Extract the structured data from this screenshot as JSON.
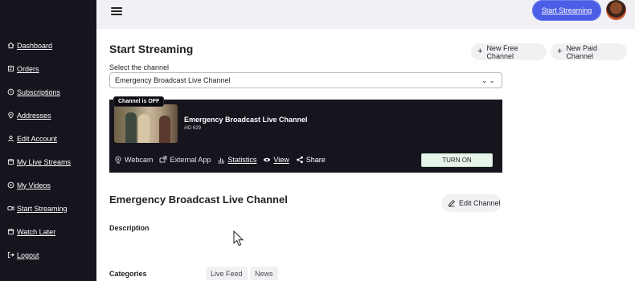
{
  "sidebar": {
    "items": [
      {
        "label": "Dashboard",
        "icon": "home-icon"
      },
      {
        "label": "Orders",
        "icon": "receipt-icon"
      },
      {
        "label": "Subscriptions",
        "icon": "clock-icon"
      },
      {
        "label": "Addresses",
        "icon": "map-pin-icon"
      },
      {
        "label": "Edit Account",
        "icon": "user-icon"
      },
      {
        "label": "My Live Streams",
        "icon": "calendar-icon"
      },
      {
        "label": "My Videos",
        "icon": "play-circle-icon"
      },
      {
        "label": "Start Streaming",
        "icon": "video-icon"
      },
      {
        "label": "Watch Later",
        "icon": "calendar-icon"
      },
      {
        "label": "Logout",
        "icon": "logout-icon"
      }
    ]
  },
  "header": {
    "start_streaming_label": "Start Streaming"
  },
  "main": {
    "title": "Start Streaming",
    "new_free_channel_label": "New Free Channel",
    "new_paid_channel_label": "New Paid Channel",
    "select_label": "Select the channel",
    "selected_channel": "Emergency Broadcast Live Channel",
    "card": {
      "status_badge": "Channel is OFF",
      "title": "Emergency Broadcast Live Channel",
      "id_text": "#ID 629",
      "actions": {
        "webcam": "Webcam",
        "external_app": "External App",
        "statistics": "Statistics",
        "view": "View",
        "share": "Share"
      },
      "turn_on_label": "TURN ON"
    },
    "section_title": "Emergency Broadcast Live Channel",
    "edit_channel_label": "Edit Channel",
    "description_label": "Description",
    "categories_label": "Categories",
    "categories": [
      "Live Feed",
      "News"
    ]
  },
  "colors": {
    "sidebar_bg": "#17141d",
    "accent": "#4c5ee6",
    "turn_on_bg": "#e6f4ea"
  }
}
